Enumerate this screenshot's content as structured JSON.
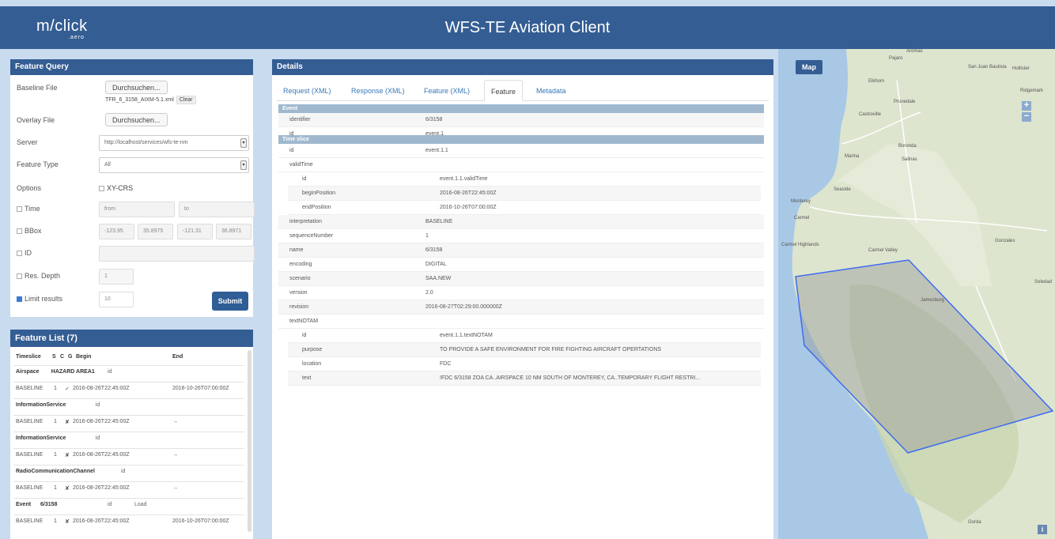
{
  "header": {
    "logo_main": "m/click",
    "logo_sub": ".aero",
    "title": "WFS-TE Aviation Client"
  },
  "query": {
    "title": "Feature Query",
    "baseline_label": "Baseline File",
    "baseline_button": "Durchsuchen...",
    "baseline_filename": "TFR_6_3158_AIXM-5.1.xml",
    "clear_label": "Clear",
    "overlay_label": "Overlay File",
    "overlay_button": "Durchsuchen...",
    "server_label": "Server",
    "server_value": "http://localhost/services/wfs-te-nm",
    "feature_type_label": "Feature Type",
    "feature_type_value": "All",
    "options_label": "Options",
    "xycrs_label": "XY-CRS",
    "time_label": "Time",
    "time_from_placeholder": "from",
    "time_to_placeholder": "to",
    "bbox_label": "BBox",
    "bbox_values": [
      "-123.95",
      "35.8975",
      "-121.31",
      "36.8971"
    ],
    "id_label": "ID",
    "res_depth_label": "Res. Depth",
    "res_depth_value": "1",
    "limit_label": "Limit results",
    "limit_value": "10",
    "submit_label": "Submit"
  },
  "feature_list": {
    "title": "Feature List",
    "count": "(7)",
    "headers": [
      "Timeslice",
      "S",
      "C",
      "G",
      "Begin",
      "End"
    ],
    "groups": [
      {
        "name": "Airspace",
        "extra": "HAZARD AREA1",
        "id": "id",
        "load": "",
        "row": [
          "BASELINE",
          "1",
          "✓",
          "2016-08-26T22:45:00Z",
          "2016-10-26T07:00:00Z"
        ]
      },
      {
        "name": "InformationService",
        "extra": "",
        "id": "id",
        "load": "",
        "row": [
          "BASELINE",
          "1",
          "✘",
          "2016-08-26T22:45:00Z",
          "→"
        ]
      },
      {
        "name": "InformationService",
        "extra": "",
        "id": "id",
        "load": "",
        "row": [
          "BASELINE",
          "1",
          "✘",
          "2016-08-26T22:45:00Z",
          "→"
        ]
      },
      {
        "name": "RadioCommunicationChannel",
        "extra": "",
        "id": "id",
        "load": "",
        "row": [
          "BASELINE",
          "1",
          "✘",
          "2016-08-26T22:45:00Z",
          "→"
        ]
      },
      {
        "name": "Event",
        "extra": "6/3158",
        "id": "id",
        "load": "Load",
        "row": [
          "BASELINE",
          "1",
          "✘",
          "2016-08-26T22:45:00Z",
          "2016-10-26T07:00:00Z"
        ]
      }
    ]
  },
  "details": {
    "title": "Details",
    "tabs": [
      "Request (XML)",
      "Response (XML)",
      "Feature (XML)",
      "Feature",
      "Metadata"
    ],
    "event_section": "Event",
    "event_rows": [
      [
        "identifier",
        "6/3158"
      ],
      [
        "id",
        "event.1"
      ]
    ],
    "timeslice_section": "Time slice",
    "ts_id": [
      "id",
      "event.1.1"
    ],
    "valid_time_label": "validTime",
    "valid_rows": [
      [
        "id",
        "event.1.1.validTime"
      ],
      [
        "beginPosition",
        "2016-08-26T22:45:00Z"
      ],
      [
        "endPosition",
        "2016-10-26T07:00:00Z"
      ]
    ],
    "mid_rows": [
      [
        "interpretation",
        "BASELINE"
      ],
      [
        "sequenceNumber",
        "1"
      ],
      [
        "name",
        "6/3158"
      ],
      [
        "encoding",
        "DIGITAL"
      ],
      [
        "scenario",
        "SAA.NEW"
      ],
      [
        "version",
        "2.0"
      ],
      [
        "revision",
        "2016-08-27T02:29:00.000000Z"
      ]
    ],
    "notam_label": "textNOTAM",
    "notam_rows": [
      [
        "id",
        "event.1.1.textNOTAM"
      ],
      [
        "purpose",
        "TO PROVIDE A SAFE ENVIRONMENT FOR FIRE FIGHTING AIRCRAFT OPERTATIONS"
      ],
      [
        "location",
        "FDC"
      ],
      [
        "text",
        "!FDC 6/3158 ZOA CA..AIRSPACE 10 NM SOUTH OF MONTEREY, CA..TEMPORARY FLIGHT RESTRI..."
      ]
    ]
  },
  "map": {
    "title": "Map",
    "zoom_in": "+",
    "zoom_out": "−",
    "info": "i",
    "towns": [
      "Aromas",
      "Pajaro",
      "San Juan Bautista",
      "Hollister",
      "Elkhorn",
      "Ridgemark",
      "Prunedale",
      "Castroville",
      "Marina",
      "Boronda",
      "Salinas",
      "Seaside",
      "Monterey",
      "Carmel",
      "Carmel Highlands",
      "Carmel Valley",
      "Gonzales",
      "Soledad",
      "Jamesburg",
      "Gorda"
    ]
  }
}
